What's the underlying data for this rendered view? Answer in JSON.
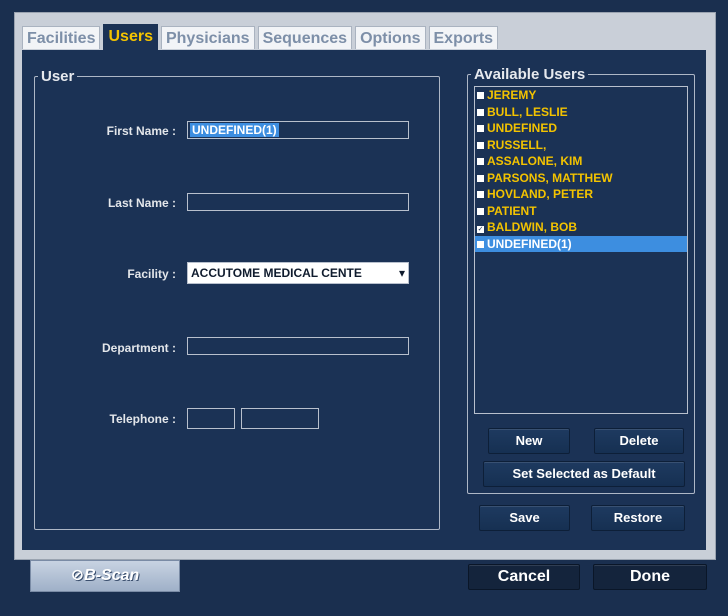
{
  "tabs": [
    "Facilities",
    "Users",
    "Physicians",
    "Sequences",
    "Options",
    "Exports"
  ],
  "active_tab": "Users",
  "user_group": {
    "legend": "User",
    "first_name_label": "First Name :",
    "first_name_value": "UNDEFINED(1)",
    "last_name_label": "Last Name :",
    "last_name_value": "",
    "facility_label": "Facility :",
    "facility_value": "ACCUTOME MEDICAL CENTE",
    "department_label": "Department :",
    "department_value": "",
    "telephone_label": "Telephone :",
    "telephone_area": "",
    "telephone_number": ""
  },
  "available_users": {
    "legend": "Available Users",
    "items": [
      {
        "name": "JEREMY",
        "checked": false,
        "selected": false
      },
      {
        "name": "BULL, LESLIE",
        "checked": false,
        "selected": false
      },
      {
        "name": "UNDEFINED",
        "checked": false,
        "selected": false
      },
      {
        "name": "RUSSELL,",
        "checked": false,
        "selected": false
      },
      {
        "name": "ASSALONE, KIM",
        "checked": false,
        "selected": false
      },
      {
        "name": "PARSONS, MATTHEW",
        "checked": false,
        "selected": false
      },
      {
        "name": "HOVLAND, PETER",
        "checked": false,
        "selected": false
      },
      {
        "name": "PATIENT",
        "checked": false,
        "selected": false
      },
      {
        "name": "BALDWIN, BOB",
        "checked": true,
        "selected": false
      },
      {
        "name": "UNDEFINED(1)",
        "checked": false,
        "selected": true
      }
    ],
    "new_label": "New",
    "delete_label": "Delete",
    "set_default_label": "Set Selected as Default"
  },
  "buttons": {
    "save": "Save",
    "restore": "Restore",
    "cancel": "Cancel",
    "done": "Done"
  },
  "logo_text": "B-Scan",
  "colors": {
    "background": "#1a2f4f",
    "panel": "#1b3255",
    "accent_yellow": "#f3c300",
    "selection_blue": "#3d8ee0"
  }
}
